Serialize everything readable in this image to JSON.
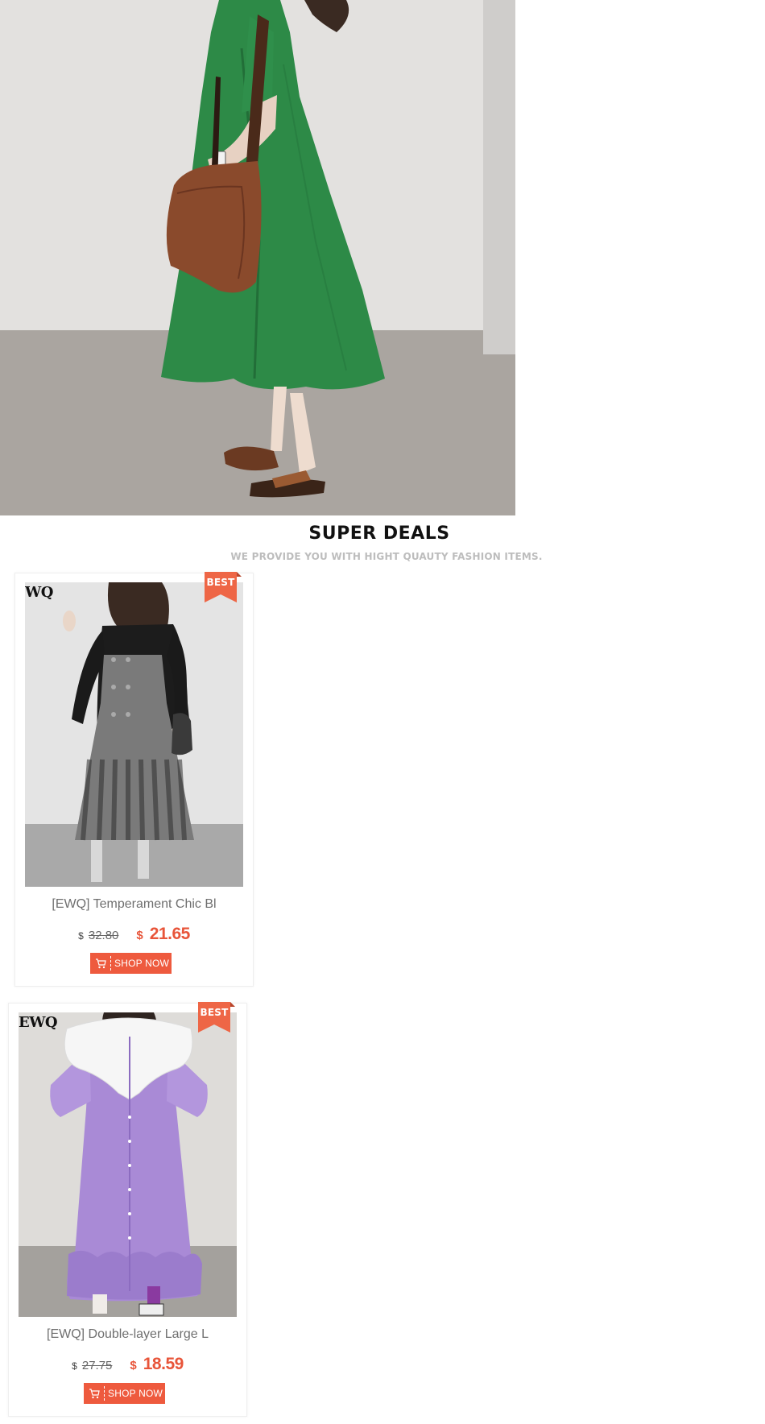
{
  "hero": {
    "image_icon": "model-green-dress-photo"
  },
  "section": {
    "title": "SUPER DEALS",
    "subtitle": "WE PROVIDE YOU WITH HIGHT QUAUTY FASHION ITEMS."
  },
  "products": [
    {
      "brand_mark": "WQ",
      "badge": "BEST",
      "title": "[EWQ] Temperament Chic Bl",
      "old_currency": "$",
      "old_price": "32.80",
      "new_currency": "$",
      "new_price": "21.65",
      "button_label": "SHOP NOW",
      "image_icon": "black-grey-pleated-dress-photo"
    },
    {
      "brand_mark": "EWQ",
      "badge": "BEST",
      "title": "[EWQ] Double-layer Large L",
      "old_currency": "$",
      "old_price": "27.75",
      "new_currency": "$",
      "new_price": "18.59",
      "button_label": "SHOP NOW",
      "image_icon": "purple-collar-dress-photo"
    }
  ],
  "colors": {
    "accent": "#ee5a3e",
    "price": "#e8553a",
    "title": "#111111",
    "subtitle": "#bdbdbd"
  }
}
